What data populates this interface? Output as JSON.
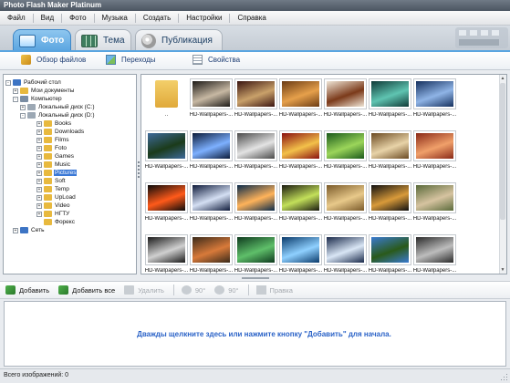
{
  "window": {
    "title": "Photo Flash Maker Platinum"
  },
  "menu": [
    "Файл",
    "Вид",
    "Фото",
    "Музыка",
    "Создать",
    "Настройки",
    "Справка"
  ],
  "tabs": [
    {
      "label": "Фото",
      "icon": "photo-tab-icon",
      "active": true
    },
    {
      "label": "Тема",
      "icon": "theme-tab-icon",
      "active": false
    },
    {
      "label": "Публикация",
      "icon": "publish-tab-icon",
      "active": false
    }
  ],
  "subtoolbar": [
    {
      "label": "Обзор файлов",
      "icon": "browse-files-icon"
    },
    {
      "label": "Переходы",
      "icon": "transitions-icon"
    },
    {
      "label": "Свойства",
      "icon": "properties-icon"
    }
  ],
  "tree": [
    {
      "label": "Рабочий стол",
      "icon": "desktop-icon",
      "level": 0,
      "expander": "-"
    },
    {
      "label": "Мои документы",
      "icon": "folder-icon",
      "level": 1,
      "expander": "+"
    },
    {
      "label": "Компьютер",
      "icon": "computer-icon",
      "level": 1,
      "expander": "-"
    },
    {
      "label": "Локальный диск (C:)",
      "icon": "drive-icon",
      "level": 2,
      "expander": "+"
    },
    {
      "label": "Локальный диск (D:)",
      "icon": "drive-icon",
      "level": 2,
      "expander": "-"
    },
    {
      "label": "Books",
      "icon": "folder-icon",
      "level": 3,
      "expander": "+"
    },
    {
      "label": "Downloads",
      "icon": "folder-icon",
      "level": 3,
      "expander": "+"
    },
    {
      "label": "Films",
      "icon": "folder-icon",
      "level": 3,
      "expander": "+"
    },
    {
      "label": "Foto",
      "icon": "folder-icon",
      "level": 3,
      "expander": "+"
    },
    {
      "label": "Games",
      "icon": "folder-icon",
      "level": 3,
      "expander": "+"
    },
    {
      "label": "Music",
      "icon": "folder-icon",
      "level": 3,
      "expander": "+"
    },
    {
      "label": "Pictures",
      "icon": "folder-icon",
      "level": 3,
      "expander": "+",
      "selected": true
    },
    {
      "label": "Soft",
      "icon": "folder-icon",
      "level": 3,
      "expander": "+"
    },
    {
      "label": "Temp",
      "icon": "folder-icon",
      "level": 3,
      "expander": "+"
    },
    {
      "label": "UpLoad",
      "icon": "folder-icon",
      "level": 3,
      "expander": "+"
    },
    {
      "label": "Video",
      "icon": "folder-icon",
      "level": 3,
      "expander": "+"
    },
    {
      "label": "НГТУ",
      "icon": "folder-icon",
      "level": 3,
      "expander": "+"
    },
    {
      "label": "Форекс",
      "icon": "folder-icon",
      "level": 3,
      "expander": ""
    },
    {
      "label": "Сеть",
      "icon": "network-icon",
      "level": 1,
      "expander": "+"
    }
  ],
  "gallery": {
    "items": [
      {
        "caption": "..",
        "kind": "parent-folder",
        "colors": [
          "#f3cf6a",
          "#e0a93a"
        ]
      },
      {
        "caption": "HD-Wallpapers-...",
        "colors": [
          "#1d1a17",
          "#c7b8a3"
        ]
      },
      {
        "caption": "HD-Wallpapers-...",
        "colors": [
          "#3a1410",
          "#c9a16a"
        ]
      },
      {
        "caption": "HD-Wallpapers-...",
        "colors": [
          "#6b3b14",
          "#e6a04b"
        ]
      },
      {
        "caption": "HD-Wallpapers-...",
        "colors": [
          "#efe5d6",
          "#7b3a1a"
        ]
      },
      {
        "caption": "HD-Wallpapers-...",
        "colors": [
          "#0f3a37",
          "#5fc4b1"
        ]
      },
      {
        "caption": "HD-Wallpapers-...",
        "colors": [
          "#15305e",
          "#8fb4e6"
        ]
      },
      {
        "caption": "HD-Wallpapers-...",
        "colors": [
          "#3e6a9a",
          "#1b3b1a"
        ]
      },
      {
        "caption": "HD-Wallpapers-...",
        "colors": [
          "#0b1b3a",
          "#7db0ff"
        ]
      },
      {
        "caption": "HD-Wallpapers-...",
        "colors": [
          "#4a4a4a",
          "#e3e3e3"
        ]
      },
      {
        "caption": "HD-Wallpapers-...",
        "colors": [
          "#8a1010",
          "#f3c14a"
        ]
      },
      {
        "caption": "HD-Wallpapers-...",
        "colors": [
          "#1b5a1b",
          "#9bd55a"
        ]
      },
      {
        "caption": "HD-Wallpapers-...",
        "colors": [
          "#6b4a22",
          "#e8d3a8"
        ]
      },
      {
        "caption": "HD-Wallpapers-...",
        "colors": [
          "#8a2a18",
          "#f0a06a"
        ]
      },
      {
        "caption": "HD-Wallpapers-...",
        "colors": [
          "#0a0a0a",
          "#ff5a1a"
        ]
      },
      {
        "caption": "HD-Wallpapers-...",
        "colors": [
          "#0e1a3a",
          "#d4dff3"
        ]
      },
      {
        "caption": "HD-Wallpapers-...",
        "colors": [
          "#0a2a4a",
          "#ffb35a"
        ]
      },
      {
        "caption": "HD-Wallpapers-...",
        "colors": [
          "#1a1a10",
          "#c3e05a"
        ]
      },
      {
        "caption": "HD-Wallpapers-...",
        "colors": [
          "#7a5a2a",
          "#e8c98a"
        ]
      },
      {
        "caption": "HD-Wallpapers-...",
        "colors": [
          "#101010",
          "#d89a3a"
        ]
      },
      {
        "caption": "HD-Wallpapers-...",
        "colors": [
          "#5a6a3a",
          "#d6c3a0"
        ]
      },
      {
        "caption": "HD-Wallpapers-...",
        "colors": [
          "#1a1a1a",
          "#d0d0d0"
        ]
      },
      {
        "caption": "HD-Wallpapers-...",
        "colors": [
          "#3a2a1a",
          "#d87a3a"
        ]
      },
      {
        "caption": "HD-Wallpapers-...",
        "colors": [
          "#0e3a1e",
          "#5fbf6a"
        ]
      },
      {
        "caption": "HD-Wallpapers-...",
        "colors": [
          "#0a3a6a",
          "#8fd0ff"
        ]
      },
      {
        "caption": "HD-Wallpapers-...",
        "colors": [
          "#1a2a4a",
          "#d9e6f5"
        ]
      },
      {
        "caption": "HD-Wallpapers-...",
        "colors": [
          "#3a7ad0",
          "#2a5a1a"
        ]
      },
      {
        "caption": "HD-Wallpapers-...",
        "colors": [
          "#2a2a2a",
          "#bdbdbd"
        ]
      }
    ]
  },
  "actions": [
    {
      "label": "Добавить",
      "icon": "add-icon",
      "enabled": true
    },
    {
      "label": "Добавить все",
      "icon": "add-all-icon",
      "enabled": true
    },
    {
      "label": "Удалить",
      "icon": "delete-icon",
      "enabled": false
    },
    {
      "label": "90°",
      "icon": "rotate-left-icon",
      "enabled": false
    },
    {
      "label": "90°",
      "icon": "rotate-right-icon",
      "enabled": false
    },
    {
      "label": "Правка",
      "icon": "edit-icon",
      "enabled": false
    }
  ],
  "droparea": {
    "hint": "Дважды щелкните здесь или нажмите кнопку \"Добавить\" для начала."
  },
  "status": {
    "text": "Всего изображений: 0"
  },
  "colors": {
    "accent": "#5aa5e0",
    "selection": "#3a78d6",
    "link": "#2a62c7",
    "folder": "#e8b93e"
  }
}
